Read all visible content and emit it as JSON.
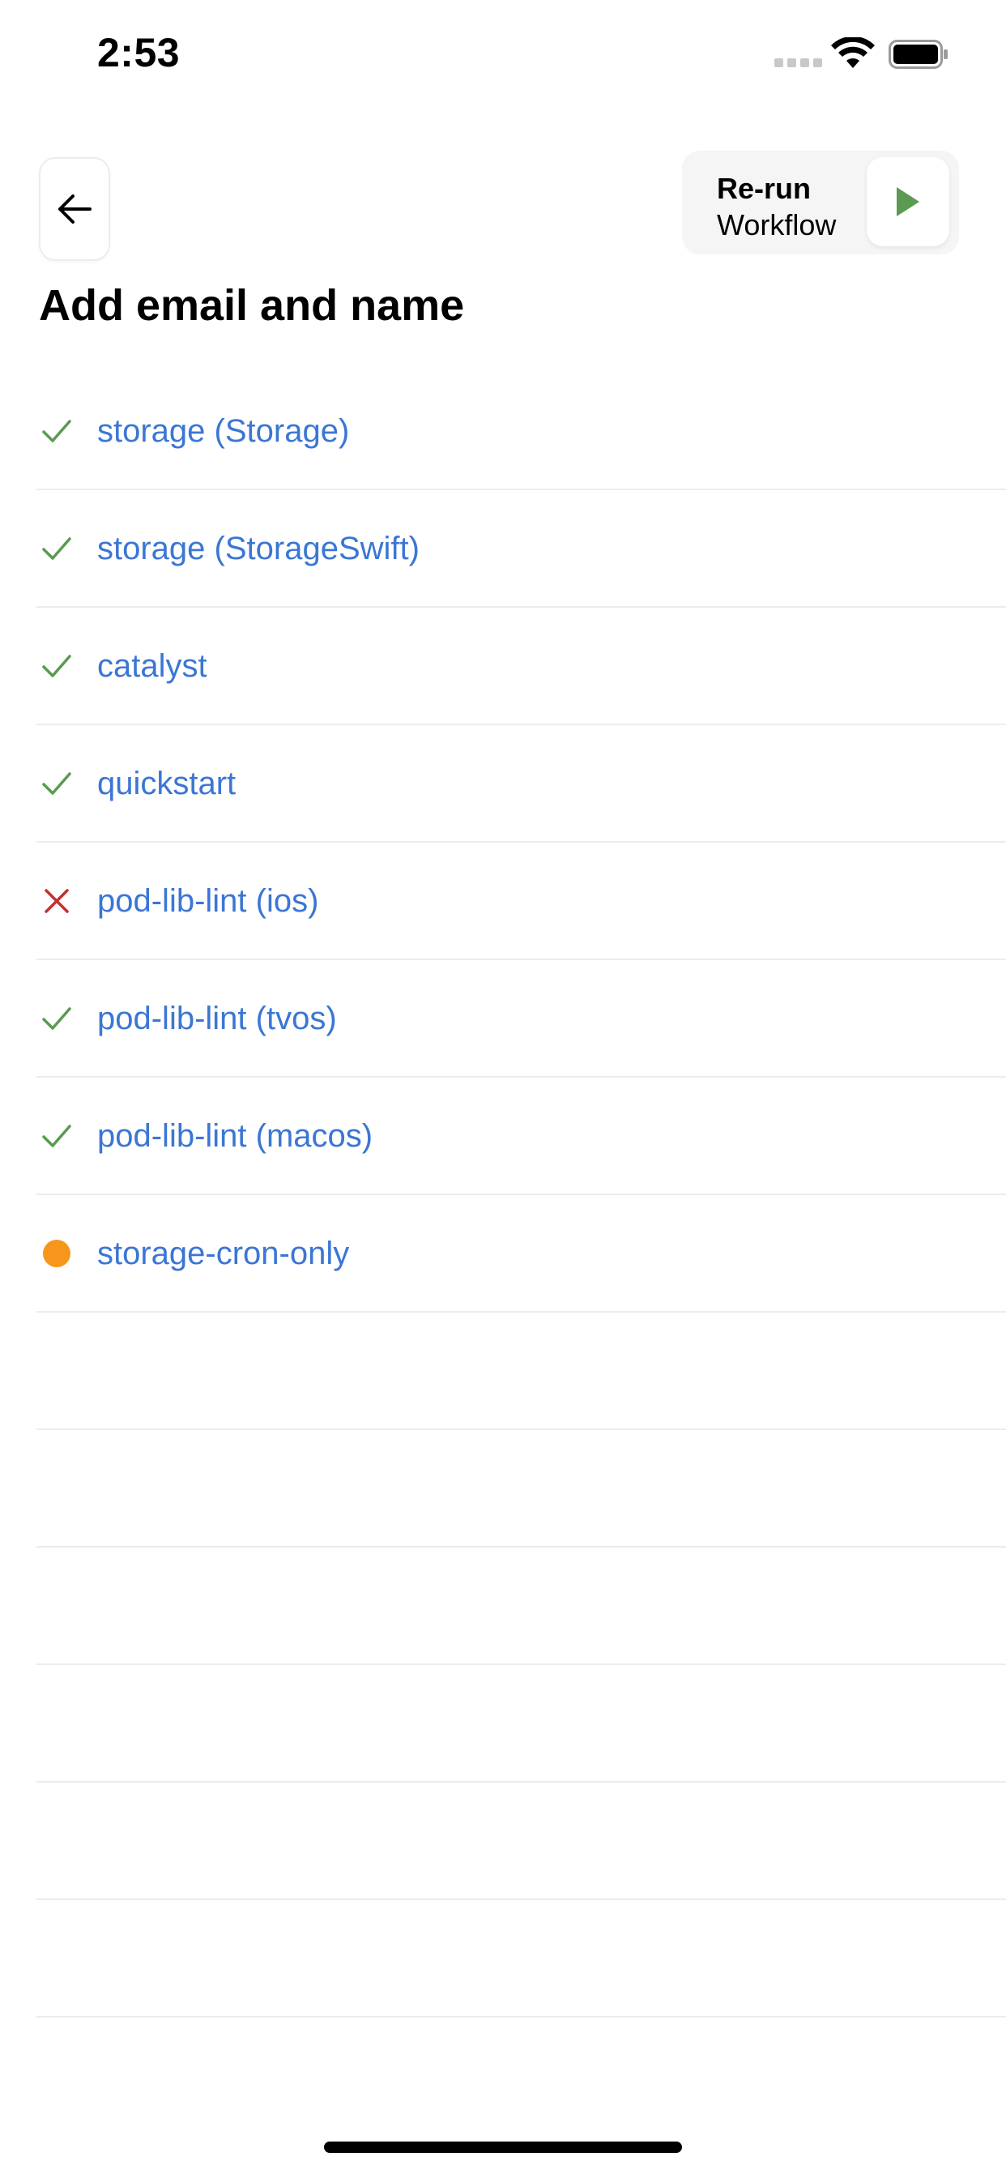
{
  "status_bar": {
    "time": "2:53",
    "signal_icon": "cellular-signal-icon",
    "wifi_icon": "wifi-icon",
    "battery_icon": "battery-icon"
  },
  "header": {
    "back_icon": "arrow-left-icon",
    "rerun": {
      "line1": "Re-run",
      "line2": "Workflow",
      "icon": "play-icon"
    }
  },
  "title": "Add email and name",
  "jobs": [
    {
      "name": "storage (Storage)",
      "status": "success"
    },
    {
      "name": "storage (StorageSwift)",
      "status": "success"
    },
    {
      "name": "catalyst",
      "status": "success"
    },
    {
      "name": "quickstart",
      "status": "success"
    },
    {
      "name": "pod-lib-lint (ios)",
      "status": "failure"
    },
    {
      "name": "pod-lib-lint (tvos)",
      "status": "success"
    },
    {
      "name": "pod-lib-lint (macos)",
      "status": "success"
    },
    {
      "name": "storage-cron-only",
      "status": "in_progress"
    }
  ],
  "colors": {
    "link": "#3b76d4",
    "success": "#5a9a52",
    "failure": "#c5302e",
    "in_progress": "#f8961c",
    "play": "#5a9a52"
  }
}
